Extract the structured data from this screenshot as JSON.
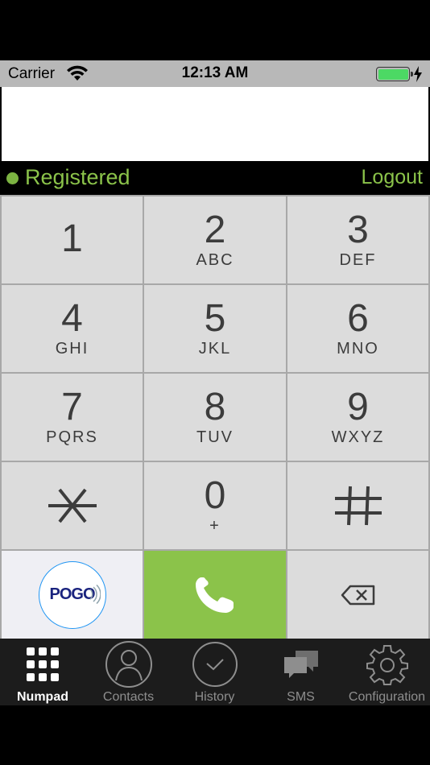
{
  "status_bar": {
    "carrier": "Carrier",
    "time": "12:13 AM",
    "battery_color": "#4cd964"
  },
  "dialer": {
    "number_value": ""
  },
  "registration": {
    "status": "Registered",
    "logout_label": "Logout",
    "status_color": "#8bc34a"
  },
  "keypad": {
    "keys": [
      {
        "digit": "1",
        "letters": ""
      },
      {
        "digit": "2",
        "letters": "ABC"
      },
      {
        "digit": "3",
        "letters": "DEF"
      },
      {
        "digit": "4",
        "letters": "GHI"
      },
      {
        "digit": "5",
        "letters": "JKL"
      },
      {
        "digit": "6",
        "letters": "MNO"
      },
      {
        "digit": "7",
        "letters": "PQRS"
      },
      {
        "digit": "8",
        "letters": "TUV"
      },
      {
        "digit": "9",
        "letters": "WXYZ"
      },
      {
        "digit": "*",
        "letters": ""
      },
      {
        "digit": "0",
        "letters": "+"
      },
      {
        "digit": "#",
        "letters": ""
      }
    ],
    "logo_text": "POGO",
    "call_icon": "phone-icon",
    "delete_icon": "backspace-icon",
    "call_color": "#8bc34a"
  },
  "tabbar": {
    "tabs": [
      {
        "label": "Numpad",
        "icon": "grid-icon",
        "active": true
      },
      {
        "label": "Contacts",
        "icon": "person-icon",
        "active": false
      },
      {
        "label": "History",
        "icon": "clock-icon",
        "active": false
      },
      {
        "label": "SMS",
        "icon": "chat-icon",
        "active": false
      },
      {
        "label": "Configuration",
        "icon": "gear-icon",
        "active": false
      }
    ]
  }
}
